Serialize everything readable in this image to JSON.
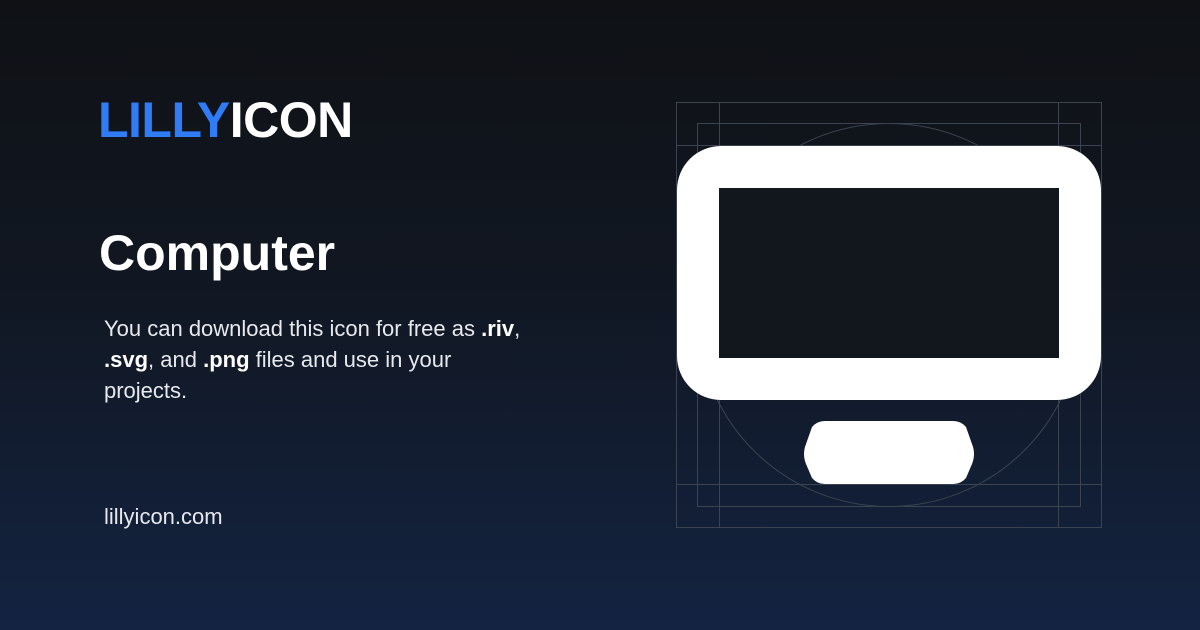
{
  "brand": {
    "part1": "LILLY",
    "part2": "ICON",
    "accent_color": "#2f7cf6"
  },
  "title": "Computer",
  "description": {
    "t1": "You can download this icon for free as ",
    "b1": ".riv",
    "t2": ", ",
    "b2": ".svg",
    "t3": ", and ",
    "b3": ".png",
    "t4": " files and use in your projects."
  },
  "website": "lillyicon.com",
  "icon": {
    "name": "computer-icon",
    "fill_color": "#ffffff",
    "grid_color": "#3c4350"
  }
}
